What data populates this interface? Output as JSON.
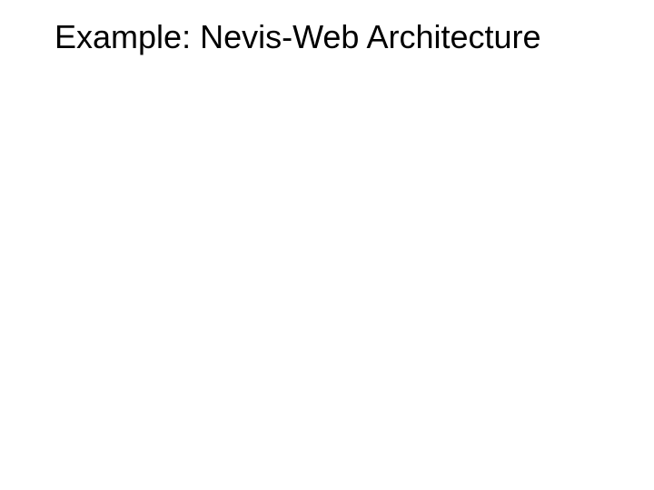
{
  "slide": {
    "title": "Example: Nevis-Web Architecture"
  }
}
